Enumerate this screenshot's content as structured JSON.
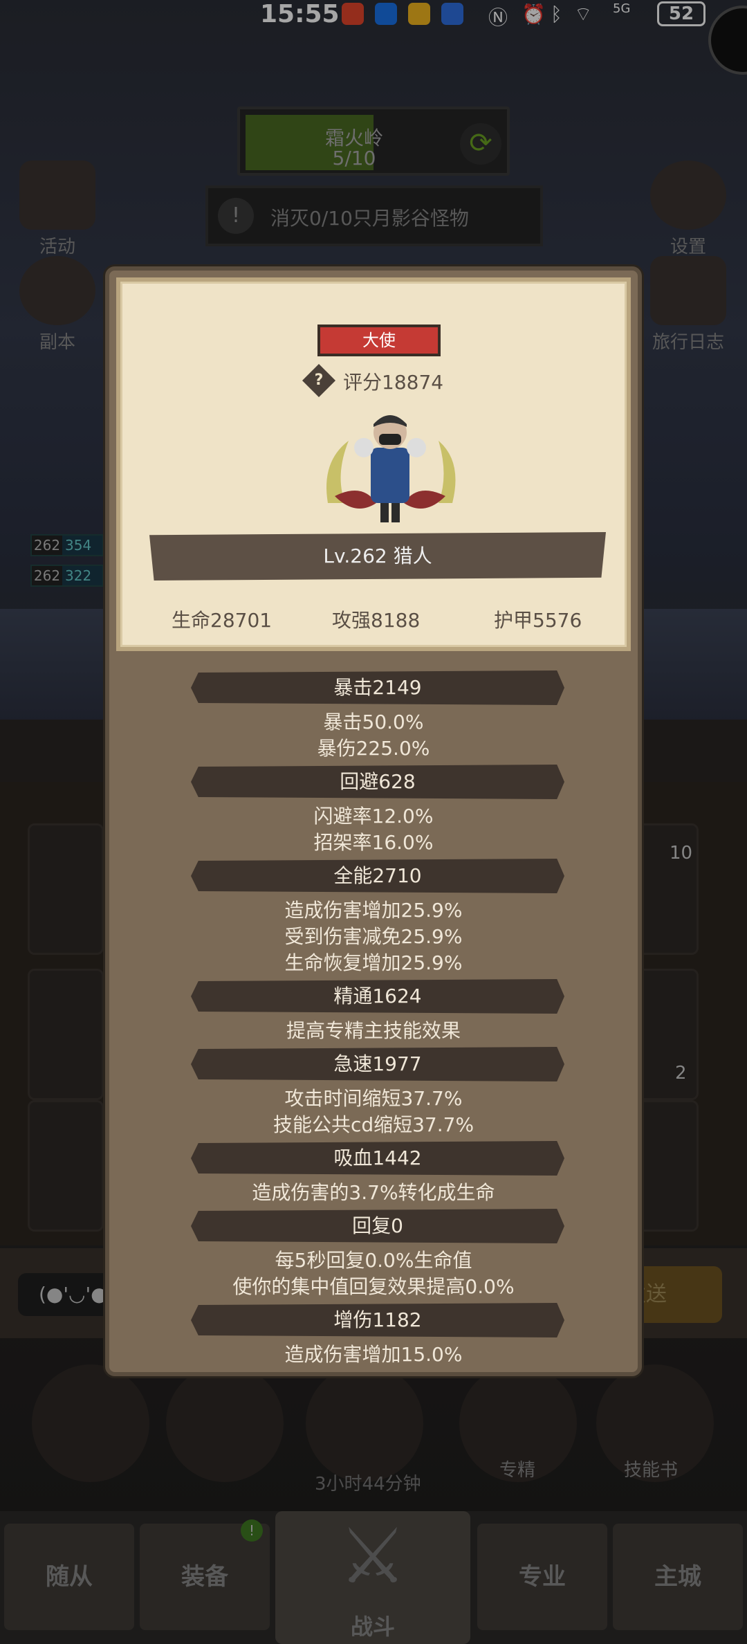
{
  "status_bar": {
    "time": "15:55",
    "signal": "5G",
    "battery": "52"
  },
  "zone": {
    "name": "霜火岭",
    "progress": "5/10",
    "progress_fraction": 0.5
  },
  "quest": {
    "text": "消灭0/10只月影谷怪物"
  },
  "side_buttons": {
    "activity": "活动",
    "settings": "设置",
    "dungeon": "副本",
    "travel_log": "旅行日志"
  },
  "party_levels": [
    {
      "level": "262",
      "value": "354"
    },
    {
      "level": "262",
      "value": "322"
    }
  ],
  "slot_counts": {
    "top_right": "10",
    "mid_right": "2"
  },
  "chat": {
    "emoji": "(●'◡'●",
    "send": "发送"
  },
  "actions": {
    "chest_timer": "3小时44分钟",
    "specialization": "专精",
    "skill_book": "技能书"
  },
  "nav": {
    "followers": "随从",
    "equipment": "装备",
    "battle": "战斗",
    "profession": "专业",
    "main_city": "主城",
    "equipment_badge": "!"
  },
  "card": {
    "rank": "大使",
    "score_label": "评分18874",
    "help_glyph": "?",
    "name": "Lv.262 猎人",
    "hp": "生命28701",
    "attack": "攻强8188",
    "armor": "护甲5576"
  },
  "stats": [
    {
      "header": "暴击2149",
      "lines": [
        "暴击50.0%",
        "暴伤225.0%"
      ]
    },
    {
      "header": "回避628",
      "lines": [
        "闪避率12.0%",
        "招架率16.0%"
      ]
    },
    {
      "header": "全能2710",
      "lines": [
        "造成伤害增加25.9%",
        "受到伤害减免25.9%",
        "生命恢复增加25.9%"
      ]
    },
    {
      "header": "精通1624",
      "lines": [
        "提高专精主技能效果"
      ]
    },
    {
      "header": "急速1977",
      "lines": [
        "攻击时间缩短37.7%",
        "技能公共cd缩短37.7%"
      ]
    },
    {
      "header": "吸血1442",
      "lines": [
        "造成伤害的3.7%转化成生命"
      ]
    },
    {
      "header": "回复0",
      "lines": [
        "每5秒回复0.0%生命值",
        "使你的集中值回复效果提高0.0%"
      ]
    },
    {
      "header": "增伤1182",
      "lines": [
        "造成伤害增加15.0%"
      ]
    }
  ]
}
